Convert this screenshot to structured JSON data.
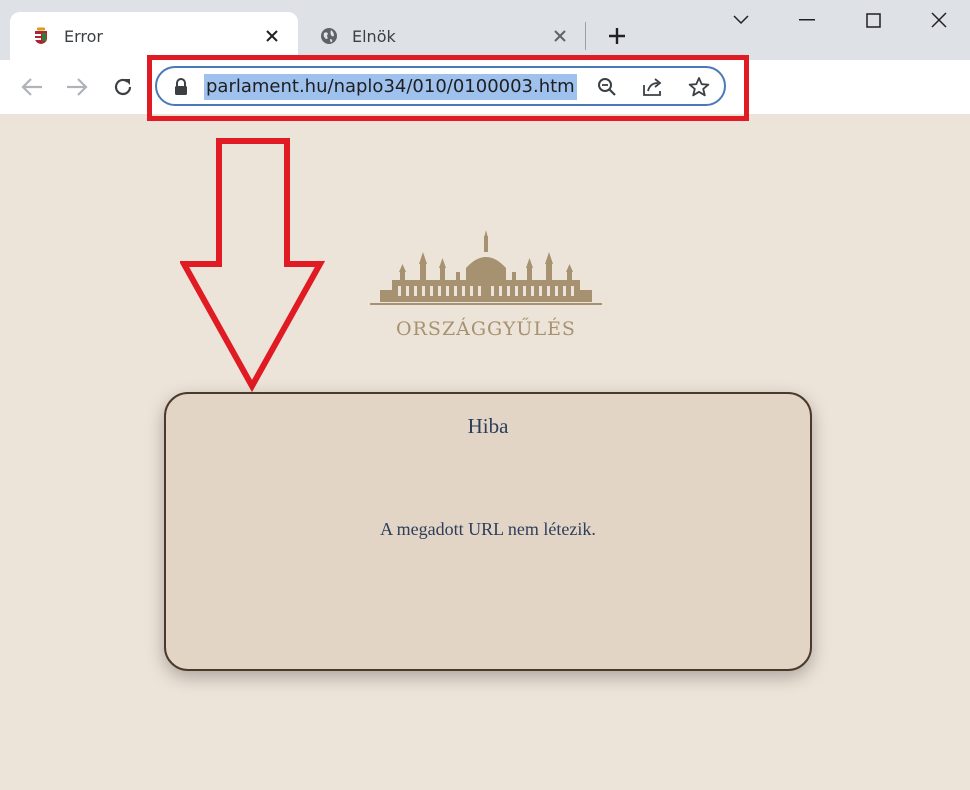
{
  "browser": {
    "tabs": [
      {
        "title": "Error",
        "active": true,
        "favicon": "hungary-coat-of-arms-icon"
      },
      {
        "title": "Elnök",
        "active": false,
        "favicon": "globe-icon"
      }
    ],
    "url": "parlament.hu/naplo34/010/0100003.htm"
  },
  "page": {
    "logo_text": "ORSZÁGGYŰLÉS",
    "error": {
      "title": "Hiba",
      "message": "A megadott URL nem létezik."
    }
  },
  "colors": {
    "page_background": "#ede4d9",
    "card_background": "#e3d5c6",
    "annotation_red": "#e01b24",
    "url_selection": "#9fc1ee",
    "logo_gold": "#a69270"
  }
}
